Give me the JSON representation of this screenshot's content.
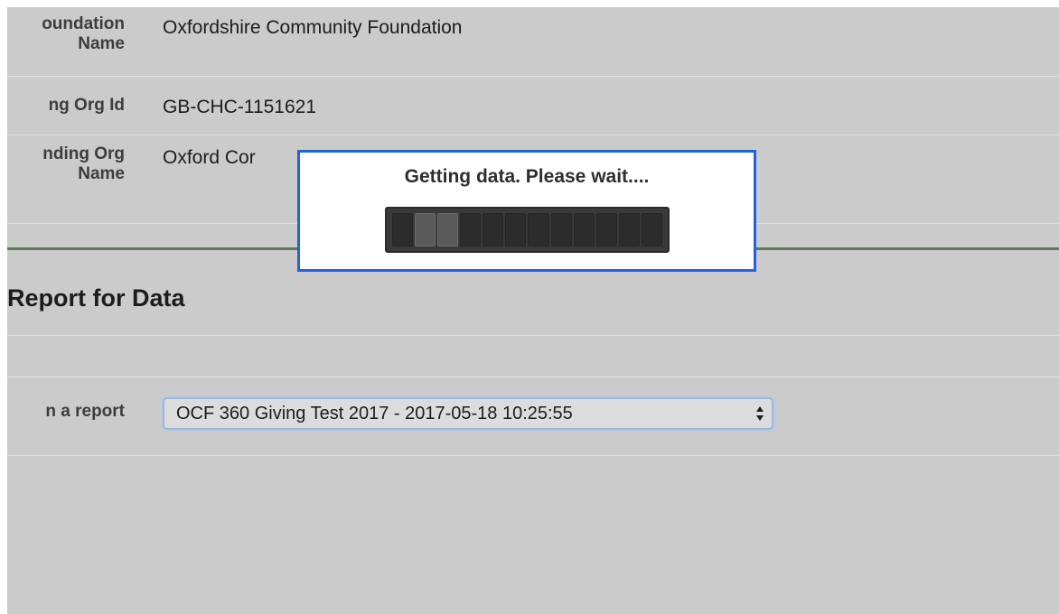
{
  "details": {
    "foundation_name_label": "oundation\nName",
    "foundation_name_value": "Oxfordshire Community Foundation",
    "org_id_label": "ng Org Id",
    "org_id_value": "GB-CHC-1151621",
    "funding_org_label": "nding Org\nName",
    "funding_org_value": "Oxford Cor"
  },
  "section": {
    "title": "Report for Data"
  },
  "report": {
    "label": "n a report",
    "selected": "OCF 360 Giving Test 2017 - 2017-05-18 10:25:55"
  },
  "loading": {
    "message": "Getting data. Please wait....",
    "segments_total": 12,
    "segments_lit": [
      1,
      2
    ]
  },
  "colors": {
    "dialog_border": "#1f63e0",
    "section_rule": "#5f7c5a"
  },
  "icons": {
    "select_arrows": "up-down-arrows-icon"
  }
}
